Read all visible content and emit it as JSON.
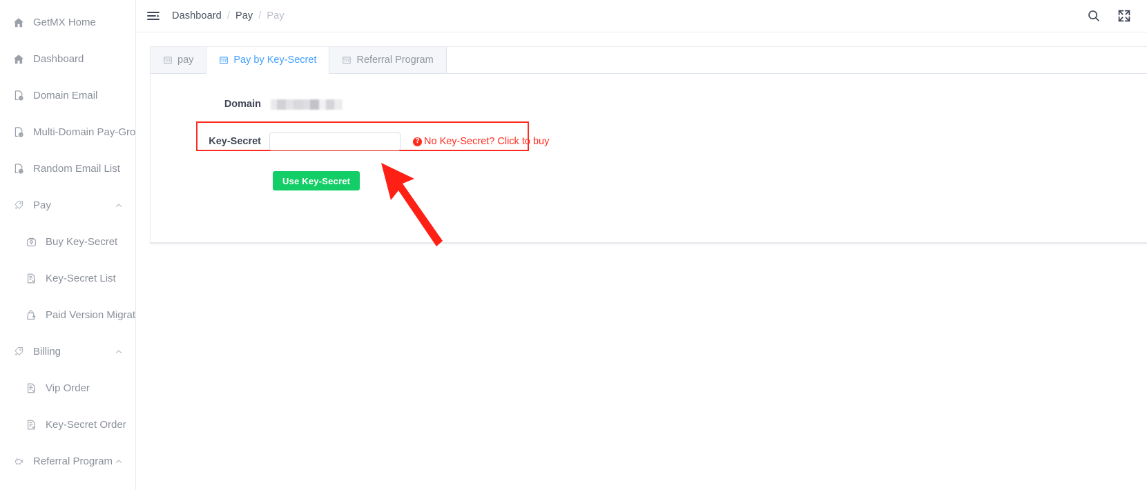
{
  "sidebar": {
    "items": [
      {
        "label": "GetMX Home",
        "icon": "home-icon",
        "level": "top",
        "caret": false
      },
      {
        "label": "Dashboard",
        "icon": "home-icon",
        "level": "top",
        "caret": false
      },
      {
        "label": "Domain Email",
        "icon": "globe-doc-icon",
        "level": "top",
        "caret": false
      },
      {
        "label": "Multi-Domain Pay-Group",
        "icon": "globe-doc-icon",
        "level": "top",
        "caret": false
      },
      {
        "label": "Random Email List",
        "icon": "globe-doc-icon",
        "level": "top",
        "caret": false
      },
      {
        "label": "Pay",
        "icon": "tag-plus-icon",
        "level": "group",
        "caret": true
      },
      {
        "label": "Buy Key-Secret",
        "icon": "key-box-icon",
        "level": "child",
        "caret": false
      },
      {
        "label": "Key-Secret List",
        "icon": "doc-list-icon",
        "level": "child",
        "caret": false
      },
      {
        "label": "Paid Version Migration",
        "icon": "upload-bag-icon",
        "level": "child",
        "caret": false
      },
      {
        "label": "Billing",
        "icon": "tag-plus-icon",
        "level": "group",
        "caret": true
      },
      {
        "label": "Vip Order",
        "icon": "doc-list-icon",
        "level": "child",
        "caret": false
      },
      {
        "label": "Key-Secret Order",
        "icon": "doc-list-icon",
        "level": "child",
        "caret": false
      },
      {
        "label": "Referral Program",
        "icon": "piggy-bank-icon",
        "level": "group",
        "caret": true
      }
    ]
  },
  "topbar": {
    "menu_icon": "hamburger-collapse-icon",
    "breadcrumb": [
      {
        "label": "Dashboard",
        "current": false
      },
      {
        "label": "Pay",
        "current": false
      },
      {
        "label": "Pay",
        "current": true
      }
    ],
    "separator": "/",
    "search_icon": "search-icon",
    "fullscreen_icon": "fullscreen-icon"
  },
  "tabs": [
    {
      "label": "pay",
      "icon": "calendar-icon",
      "active": false
    },
    {
      "label": "Pay by Key-Secret",
      "icon": "calendar-icon",
      "active": true
    },
    {
      "label": "Referral Program",
      "icon": "calendar-icon",
      "active": false
    }
  ],
  "form": {
    "domain_label": "Domain",
    "domain_value_redacted": true,
    "key_secret_label": "Key-Secret",
    "key_secret_value": "",
    "key_secret_placeholder": "",
    "buy_link_text": "No Key-Secret? Click to buy",
    "buy_link_icon": "question-circle-icon",
    "submit_label": "Use Key-Secret"
  },
  "annotations": {
    "highlight_box_color": "#fe2a1f",
    "arrow_color": "#fe2015",
    "arrow_icon": "pointer-arrow-annotation"
  },
  "colors": {
    "accent_blue": "#409eff",
    "success_green": "#13ce66",
    "danger_red": "#ff2b1e",
    "text_primary": "#3f4754",
    "text_muted": "#8a8f99"
  }
}
